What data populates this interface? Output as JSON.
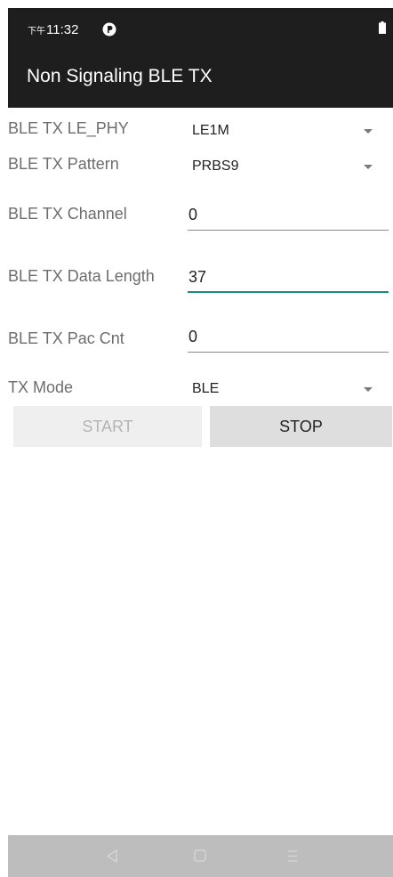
{
  "status_bar": {
    "ampm": "下午",
    "time": "11:32"
  },
  "app_bar": {
    "title": "Non Signaling BLE TX"
  },
  "form": {
    "le_phy": {
      "label": "BLE TX LE_PHY",
      "value": "LE1M"
    },
    "pattern": {
      "label": "BLE TX Pattern",
      "value": "PRBS9"
    },
    "channel": {
      "label": "BLE TX Channel",
      "value": "0"
    },
    "data_length": {
      "label": "BLE TX Data Length",
      "value": "37"
    },
    "pac_cnt": {
      "label": "BLE TX Pac Cnt",
      "value": "0"
    },
    "tx_mode": {
      "label": "TX Mode",
      "value": "BLE"
    }
  },
  "buttons": {
    "start": "START",
    "stop": "STOP"
  },
  "colors": {
    "bar_dark": "#1e1e1e",
    "accent": "#1a8c84",
    "nav_bar": "#bdbdbd",
    "label_gray": "#6d6d6d"
  },
  "icons": {
    "status_app": "app-notification-icon",
    "battery": "battery-icon",
    "back": "back-triangle-icon",
    "home": "home-square-icon",
    "menu": "menu-lines-icon"
  }
}
